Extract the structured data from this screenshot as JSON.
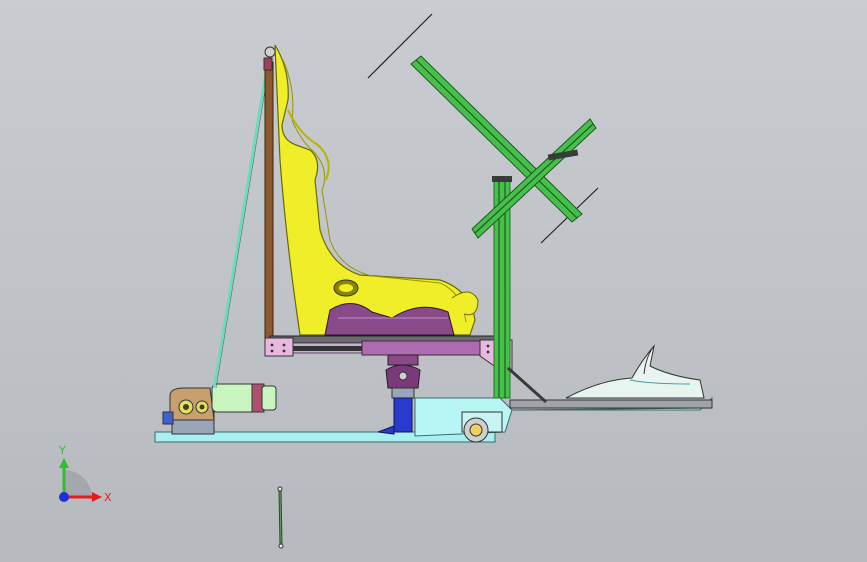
{
  "triad": {
    "y_label": "Y",
    "x_label": "X",
    "y_color": "#2fbf2f",
    "x_color": "#e02020",
    "z_color": "#2030d8"
  },
  "palette": {
    "background": "#c4c7cc",
    "seat": "#f0ee28",
    "seat_shadow": "#b8b400",
    "frame_green": "#46c04a",
    "frame_green_dark": "#1e7a22",
    "post_brown": "#8a5a2e",
    "plate_pink": "#e8b8e0",
    "slider_purple": "#8a4a8a",
    "base_cyan": "#a8f0f0",
    "actuator_blue": "#2a3ad0",
    "motor_green": "#b8f0b8",
    "gear_tan": "#c8a070",
    "rail_gray": "#6a6a70"
  }
}
